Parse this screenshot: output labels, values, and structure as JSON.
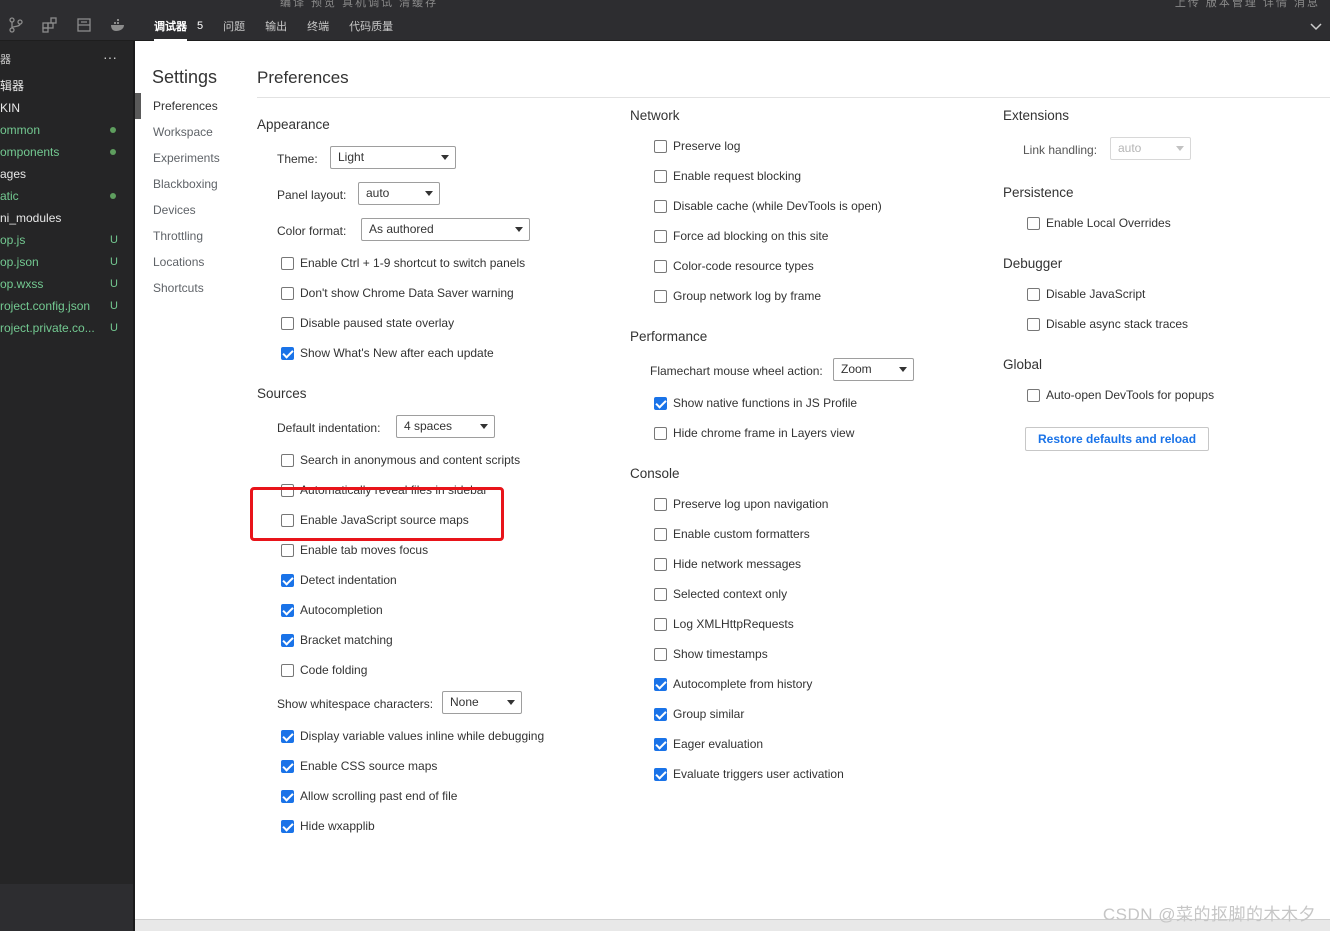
{
  "topbar": {
    "ghost_left": "编译   预览   真机调试   清缓存",
    "ghost_right": "上传   版本管理   详情   消息",
    "tabs": [
      {
        "label": "调试器",
        "active": true
      },
      {
        "label": "问题"
      },
      {
        "label": "输出"
      },
      {
        "label": "终端"
      },
      {
        "label": "代码质量"
      }
    ],
    "debugger_count": "5"
  },
  "explorer": {
    "header": "器",
    "more": "···",
    "items": [
      {
        "name": "辑器",
        "color": "#e8e8e8",
        "status": ""
      },
      {
        "name": "KIN",
        "color": "#e8e8e8",
        "status": ""
      },
      {
        "name": "ommon",
        "color": "#73c991",
        "status": "dot"
      },
      {
        "name": "omponents",
        "color": "#73c991",
        "status": "dot"
      },
      {
        "name": "ages",
        "color": "#e8e8e8",
        "status": ""
      },
      {
        "name": "atic",
        "color": "#73c991",
        "status": "dot"
      },
      {
        "name": "ni_modules",
        "color": "#e8e8e8",
        "status": ""
      },
      {
        "name": "op.js",
        "color": "#73c991",
        "status": "U"
      },
      {
        "name": "op.json",
        "color": "#73c991",
        "status": "U"
      },
      {
        "name": "op.wxss",
        "color": "#73c991",
        "status": "U"
      },
      {
        "name": "roject.config.json",
        "color": "#73c991",
        "status": "U"
      },
      {
        "name": "roject.private.co...",
        "color": "#73c991",
        "status": "U"
      }
    ]
  },
  "settings": {
    "title": "Settings",
    "nav": [
      "Preferences",
      "Workspace",
      "Experiments",
      "Blackboxing",
      "Devices",
      "Throttling",
      "Locations",
      "Shortcuts"
    ],
    "selected": "Preferences"
  },
  "preferences": {
    "title": "Preferences",
    "appearance": {
      "title": "Appearance",
      "theme_label": "Theme:",
      "theme_value": "Light",
      "panel_layout_label": "Panel layout:",
      "panel_layout_value": "auto",
      "color_format_label": "Color format:",
      "color_format_value": "As authored",
      "checks": [
        {
          "label": "Enable Ctrl + 1-9 shortcut to switch panels",
          "checked": false
        },
        {
          "label": "Don't show Chrome Data Saver warning",
          "checked": false
        },
        {
          "label": "Disable paused state overlay",
          "checked": false
        },
        {
          "label": "Show What's New after each update",
          "checked": true
        }
      ]
    },
    "sources": {
      "title": "Sources",
      "indent_label": "Default indentation:",
      "indent_value": "4 spaces",
      "checks": [
        {
          "label": "Search in anonymous and content scripts",
          "checked": false
        },
        {
          "label": "Automatically reveal files in sidebar",
          "checked": false
        },
        {
          "label": "Enable JavaScript source maps",
          "checked": false
        },
        {
          "label": "Enable tab moves focus",
          "checked": false
        },
        {
          "label": "Detect indentation",
          "checked": true
        },
        {
          "label": "Autocompletion",
          "checked": true
        },
        {
          "label": "Bracket matching",
          "checked": true
        },
        {
          "label": "Code folding",
          "checked": false
        }
      ],
      "whitespace_label": "Show whitespace characters:",
      "whitespace_value": "None",
      "checks2": [
        {
          "label": "Display variable values inline while debugging",
          "checked": true
        },
        {
          "label": "Enable CSS source maps",
          "checked": true
        },
        {
          "label": "Allow scrolling past end of file",
          "checked": true
        },
        {
          "label": "Hide wxapplib",
          "checked": true
        }
      ]
    },
    "network": {
      "title": "Network",
      "checks": [
        {
          "label": "Preserve log",
          "checked": false
        },
        {
          "label": "Enable request blocking",
          "checked": false
        },
        {
          "label": "Disable cache (while DevTools is open)",
          "checked": false
        },
        {
          "label": "Force ad blocking on this site",
          "checked": false
        },
        {
          "label": "Color-code resource types",
          "checked": false
        },
        {
          "label": "Group network log by frame",
          "checked": false
        }
      ]
    },
    "performance": {
      "title": "Performance",
      "flame_label": "Flamechart mouse wheel action:",
      "flame_value": "Zoom",
      "checks": [
        {
          "label": "Show native functions in JS Profile",
          "checked": true
        },
        {
          "label": "Hide chrome frame in Layers view",
          "checked": false
        }
      ]
    },
    "console": {
      "title": "Console",
      "checks": [
        {
          "label": "Preserve log upon navigation",
          "checked": false
        },
        {
          "label": "Enable custom formatters",
          "checked": false
        },
        {
          "label": "Hide network messages",
          "checked": false
        },
        {
          "label": "Selected context only",
          "checked": false
        },
        {
          "label": "Log XMLHttpRequests",
          "checked": false
        },
        {
          "label": "Show timestamps",
          "checked": false
        },
        {
          "label": "Autocomplete from history",
          "checked": true
        },
        {
          "label": "Group similar",
          "checked": true
        },
        {
          "label": "Eager evaluation",
          "checked": true
        },
        {
          "label": "Evaluate triggers user activation",
          "checked": true
        }
      ]
    },
    "extensions": {
      "title": "Extensions",
      "link_label": "Link handling:",
      "link_value": "auto"
    },
    "persistence": {
      "title": "Persistence",
      "checks": [
        {
          "label": "Enable Local Overrides",
          "checked": false
        }
      ]
    },
    "debugger": {
      "title": "Debugger",
      "checks": [
        {
          "label": "Disable JavaScript",
          "checked": false
        },
        {
          "label": "Disable async stack traces",
          "checked": false
        }
      ]
    },
    "global": {
      "title": "Global",
      "checks": [
        {
          "label": "Auto-open DevTools for popups",
          "checked": false
        }
      ],
      "restore_label": "Restore defaults and reload"
    }
  },
  "watermark": "CSDN @菜的抠脚的木木夕"
}
